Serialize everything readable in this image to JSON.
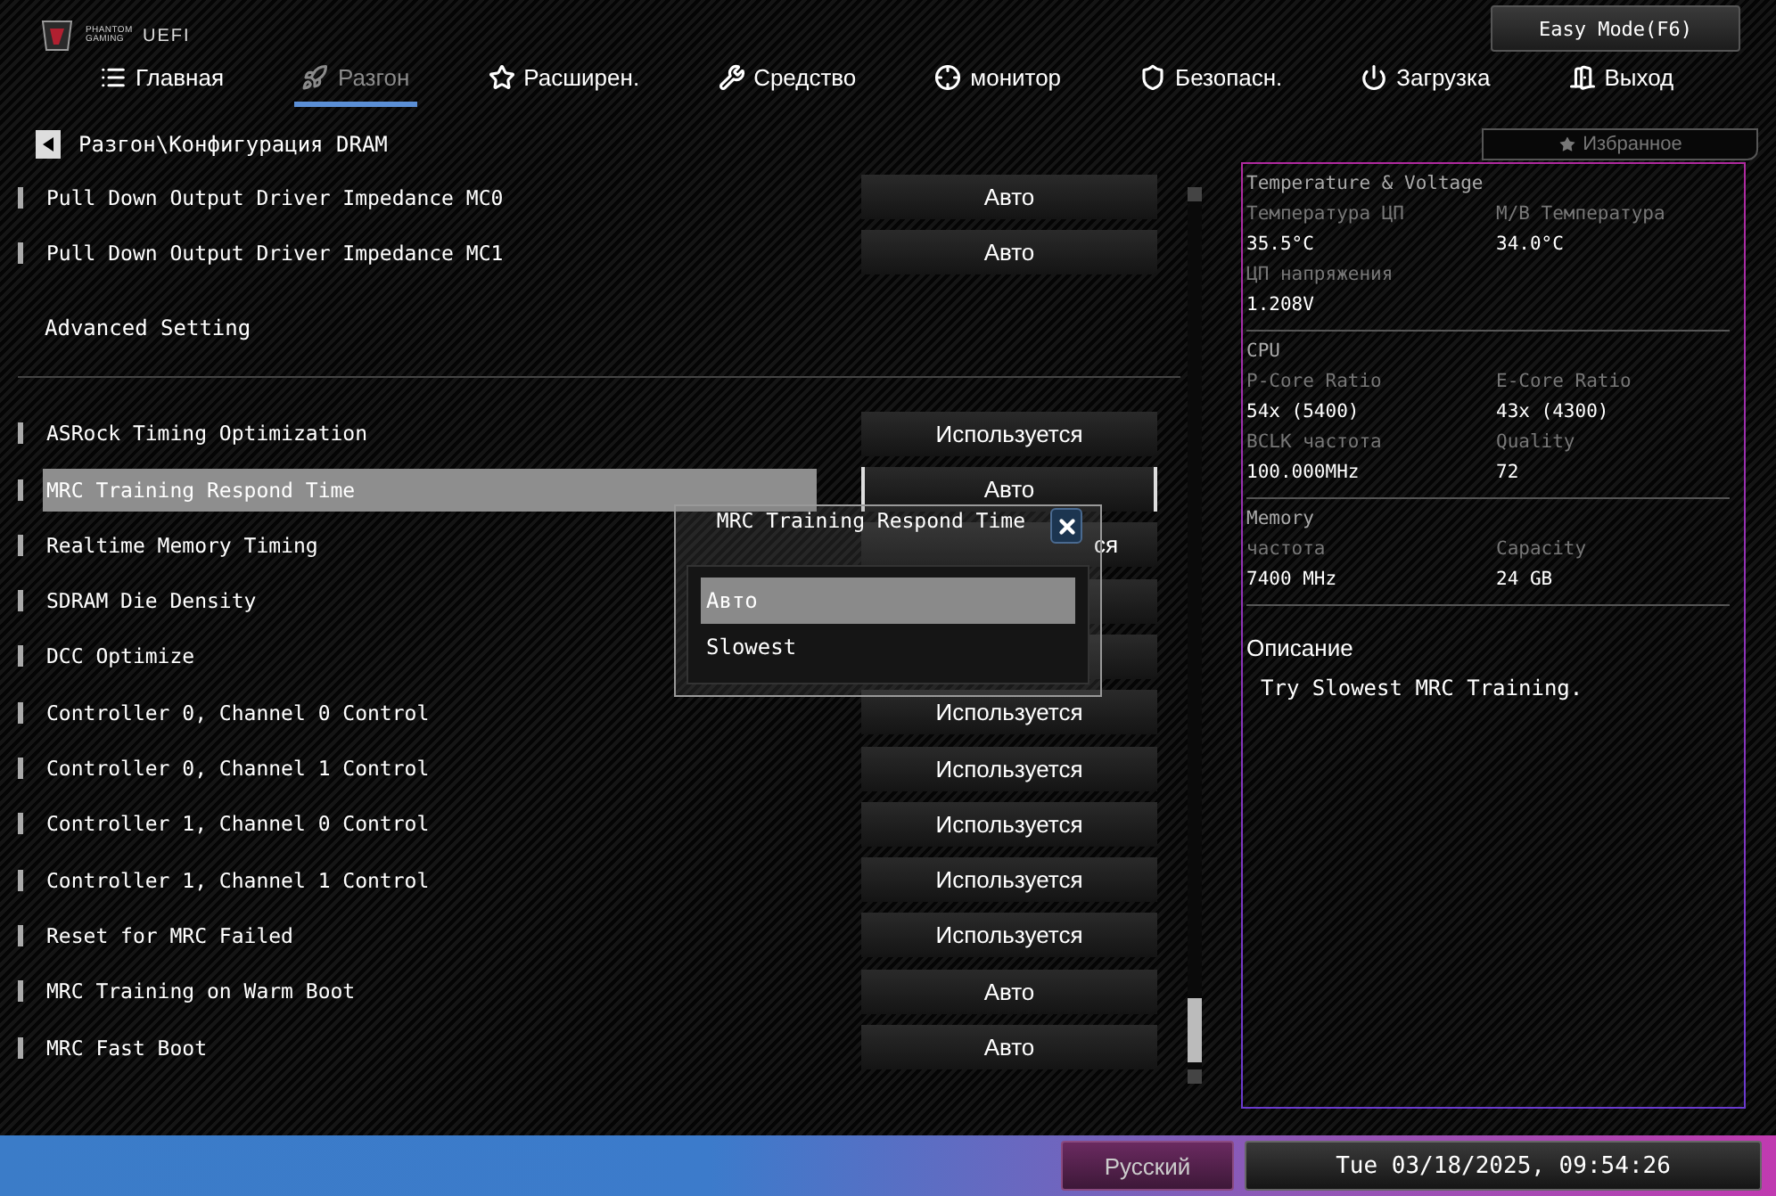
{
  "header": {
    "brand": "PHANTOM GAMING",
    "uefi": "UEFI",
    "mode_button": "Easy Mode(F6)"
  },
  "tabs": [
    {
      "label": "Главная",
      "selected": false
    },
    {
      "label": "Разгон",
      "selected": true
    },
    {
      "label": "Расширен.",
      "selected": false
    },
    {
      "label": "Средство",
      "selected": false
    },
    {
      "label": "монитор",
      "selected": false
    },
    {
      "label": "Безопасн.",
      "selected": false
    },
    {
      "label": "Загрузка",
      "selected": false
    },
    {
      "label": "Выход",
      "selected": false
    }
  ],
  "breadcrumb": "Разгон\\Конфигурация DRAM",
  "favorites": "Избранное",
  "settings": [
    {
      "kind": "option",
      "label": "Pull Down Output Driver Impedance MC0",
      "value": "Авто",
      "selected": false
    },
    {
      "kind": "option",
      "label": "Pull Down Output Driver Impedance MC1",
      "value": "Авто",
      "selected": false
    },
    {
      "kind": "heading",
      "label": "Advanced Setting"
    },
    {
      "kind": "option",
      "label": "ASRock Timing Optimization",
      "value": "Используется",
      "selected": false
    },
    {
      "kind": "option",
      "label": "MRC Training Respond Time",
      "value": "Авто",
      "selected": true
    },
    {
      "kind": "covered",
      "label": "Realtime Memory Timing",
      "value": "ся",
      "selected": false
    },
    {
      "kind": "option",
      "label": "SDRAM Die Density",
      "selected": false
    },
    {
      "kind": "option",
      "label": "DCC Optimize",
      "selected": false
    },
    {
      "kind": "option",
      "label": "Controller 0, Channel 0 Control",
      "value": "Используется",
      "selected": false
    },
    {
      "kind": "option",
      "label": "Controller 0, Channel 1 Control",
      "value": "Используется",
      "selected": false
    },
    {
      "kind": "option",
      "label": "Controller 1, Channel 0 Control",
      "value": "Используется",
      "selected": false
    },
    {
      "kind": "option",
      "label": "Controller 1, Channel 1 Control",
      "value": "Используется",
      "selected": false
    },
    {
      "kind": "option",
      "label": "Reset for MRC Failed",
      "value": "Используется",
      "selected": false
    },
    {
      "kind": "option",
      "label": "MRC Training on Warm Boot",
      "value": "Авто",
      "selected": false
    },
    {
      "kind": "option",
      "label": "MRC Fast Boot",
      "value": "Авто",
      "selected": false
    }
  ],
  "popup": {
    "title": "MRC Training Respond Time",
    "options": [
      {
        "label": "Авто",
        "selected": true
      },
      {
        "label": "Slowest",
        "selected": false
      }
    ]
  },
  "info": {
    "sections": [
      {
        "title": "Temperature & Voltage",
        "items": [
          {
            "label": "Температура ЦП",
            "value": "35.5°C"
          },
          {
            "label": "M/B Температура",
            "value": "34.0°C"
          },
          {
            "label": "ЦП напряжения",
            "value": "1.208V"
          }
        ]
      },
      {
        "title": "CPU",
        "items": [
          {
            "label": "P-Core Ratio",
            "value": "54x (5400)"
          },
          {
            "label": "E-Core Ratio",
            "value": "43x (4300)"
          },
          {
            "label": "BCLK частота",
            "value": "100.000MHz"
          },
          {
            "label": "Quality",
            "value": "72"
          }
        ]
      },
      {
        "title": "Memory",
        "items": [
          {
            "label": "частота",
            "value": "7400 MHz"
          },
          {
            "label": "Capacity",
            "value": "24 GB"
          }
        ]
      }
    ],
    "description": {
      "title": "Описание",
      "text": "Try Slowest MRC Training."
    }
  },
  "status_bar": {
    "language": "Русский",
    "datetime": "Tue 03/18/2025, 09:54:26"
  }
}
